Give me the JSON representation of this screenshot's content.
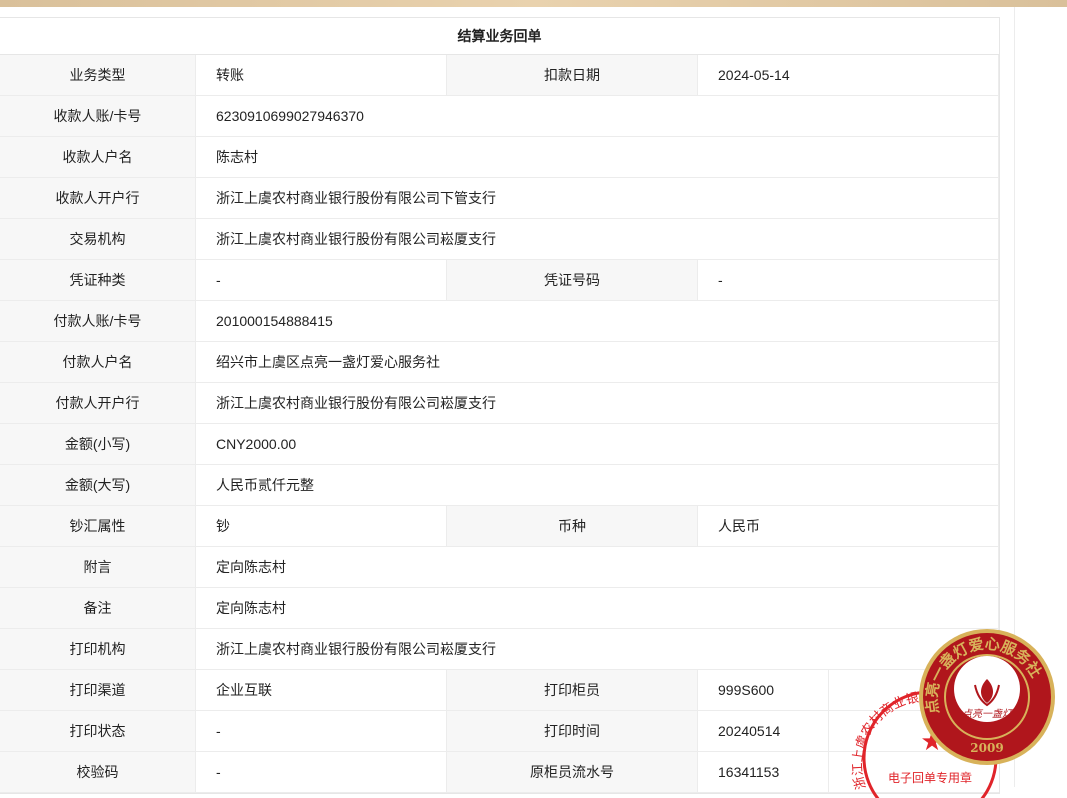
{
  "receipt": {
    "title": "结算业务回单",
    "rows": [
      {
        "l1": "业务类型",
        "v1": "转账",
        "l2": "扣款日期",
        "v2": "2024-05-14"
      },
      {
        "l1": "收款人账/卡号",
        "v1": "6230910699027946370"
      },
      {
        "l1": "收款人户名",
        "v1": "陈志村"
      },
      {
        "l1": "收款人开户行",
        "v1": "浙江上虞农村商业银行股份有限公司下管支行"
      },
      {
        "l1": "交易机构",
        "v1": "浙江上虞农村商业银行股份有限公司崧厦支行"
      },
      {
        "l1": "凭证种类",
        "v1": "-",
        "l2": "凭证号码",
        "v2": "-"
      },
      {
        "l1": "付款人账/卡号",
        "v1": "201000154888415"
      },
      {
        "l1": "付款人户名",
        "v1": "绍兴市上虞区点亮一盏灯爱心服务社"
      },
      {
        "l1": "付款人开户行",
        "v1": "浙江上虞农村商业银行股份有限公司崧厦支行"
      },
      {
        "l1": "金额(小写)",
        "v1": "CNY2000.00"
      },
      {
        "l1": "金额(大写)",
        "v1": "人民币贰仟元整"
      },
      {
        "l1": "钞汇属性",
        "v1": "钞",
        "l2": "币种",
        "v2": "人民币"
      },
      {
        "l1": "附言",
        "v1": "定向陈志村"
      },
      {
        "l1": "备注",
        "v1": "定向陈志村"
      },
      {
        "l1": "打印机构",
        "v1": "浙江上虞农村商业银行股份有限公司崧厦支行"
      },
      {
        "l1": "打印渠道",
        "v1": "企业互联",
        "l2": "打印柜员",
        "v2": "999S600"
      },
      {
        "l1": "打印状态",
        "v1": "-",
        "l2": "打印时间",
        "v2": "20240514"
      },
      {
        "l1": "校验码",
        "v1": "-",
        "l2": "原柜员流水号",
        "v2": "16341153"
      }
    ]
  },
  "seal": {
    "text": "点亮一盏灯爱心服务社",
    "inner": "点亮一盏灯",
    "year": "2009",
    "color": "#b0161c",
    "ring": "#d8b25a"
  },
  "bank_stamp": {
    "text": "浙江上虞农村商业银行",
    "caption": "电子回单专用章",
    "color": "#e0242a"
  }
}
